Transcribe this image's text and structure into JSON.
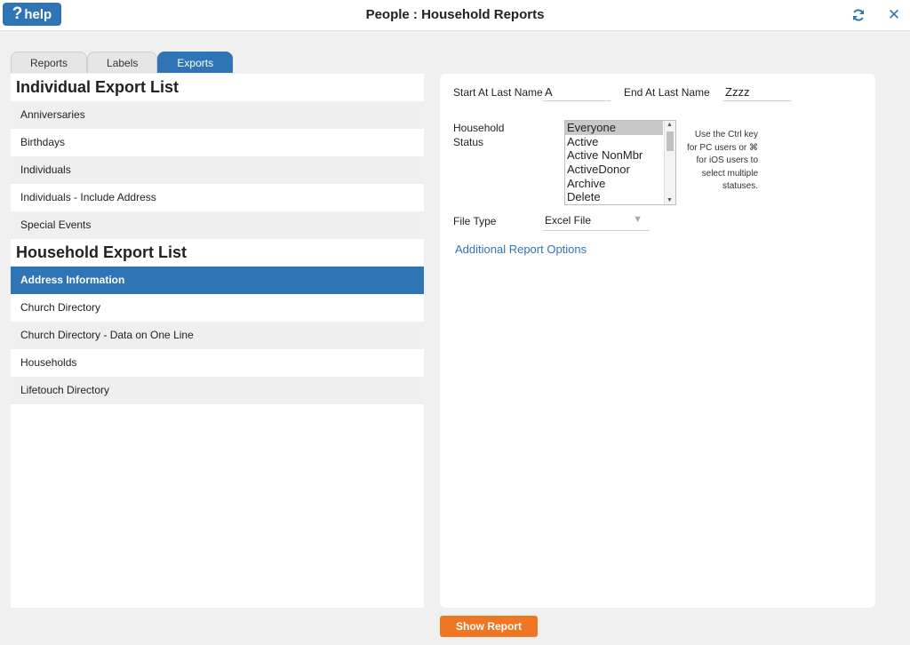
{
  "header": {
    "help_label": "help",
    "title": "People : Household Reports"
  },
  "tabs": [
    {
      "label": "Reports"
    },
    {
      "label": "Labels"
    },
    {
      "label": "Exports"
    }
  ],
  "individual_list": {
    "title": "Individual Export List",
    "items": [
      "Anniversaries",
      "Birthdays",
      "Individuals",
      "Individuals - Include Address",
      "Special Events"
    ]
  },
  "household_list": {
    "title": "Household Export List",
    "items": [
      "Address Information",
      "Church Directory",
      "Church Directory - Data on One Line",
      "Households",
      "Lifetouch Directory"
    ],
    "selected": "Address Information"
  },
  "form": {
    "start_label": "Start At Last Name",
    "start_value": "A",
    "end_label": "End At Last Name",
    "end_value": "Zzzz",
    "status_label_1": "Household",
    "status_label_2": "Status",
    "status_options": [
      "Everyone",
      "Active",
      "Active NonMbr",
      "ActiveDonor",
      "Archive",
      "Delete"
    ],
    "status_selected": "Everyone",
    "hint_lines": [
      "Use the Ctrl key",
      "for PC users or ⌘",
      "for iOS users to",
      "select multiple",
      "statuses."
    ],
    "file_type_label": "File Type",
    "file_type_value": "Excel File",
    "additional_link": "Additional Report Options"
  },
  "footer": {
    "show_report_label": "Show Report"
  },
  "colors": {
    "accent": "#2f74b5",
    "button": "#ef7622"
  }
}
